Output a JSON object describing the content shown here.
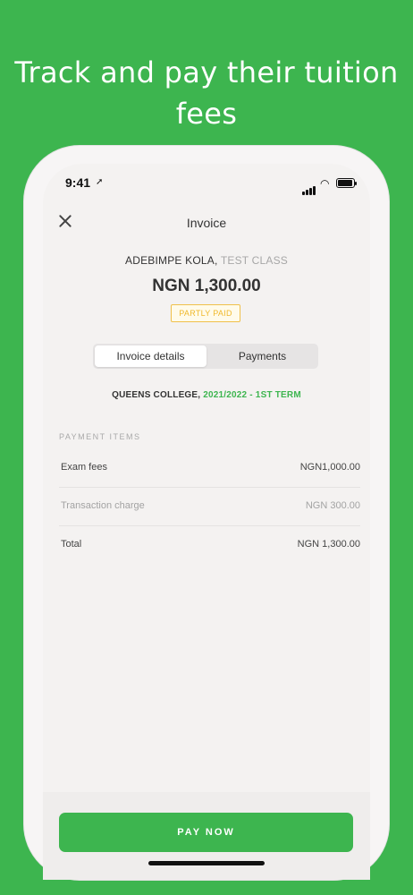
{
  "promo": {
    "headline": "Track and pay their tuition fees"
  },
  "status_bar": {
    "time": "9:41",
    "location_arrow": "location-icon",
    "icons": [
      "signal-icon",
      "wifi-icon",
      "battery-icon"
    ]
  },
  "nav": {
    "title": "Invoice",
    "close_icon": "close-icon"
  },
  "invoice": {
    "student_name": "ADEBIMPE KOLA,",
    "class_name": "TEST CLASS",
    "amount": "NGN 1,300.00",
    "status": "PARTLY PAID",
    "school": "QUEENS COLLEGE,",
    "term": "2021/2022 - 1ST TERM"
  },
  "tabs": [
    {
      "label": "Invoice details",
      "active": true
    },
    {
      "label": "Payments",
      "active": false
    }
  ],
  "payment_items": {
    "section_label": "PAYMENT ITEMS",
    "rows": [
      {
        "label": "Exam fees",
        "value": "NGN1,000.00"
      },
      {
        "label": "Transaction charge",
        "value": "NGN 300.00"
      },
      {
        "label": "Total",
        "value": "NGN 1,300.00"
      }
    ]
  },
  "actions": {
    "pay_now": "PAY NOW"
  },
  "colors": {
    "brand_green": "#3db54f",
    "badge_yellow": "#f0b92c",
    "background": "#f4f2f1"
  }
}
